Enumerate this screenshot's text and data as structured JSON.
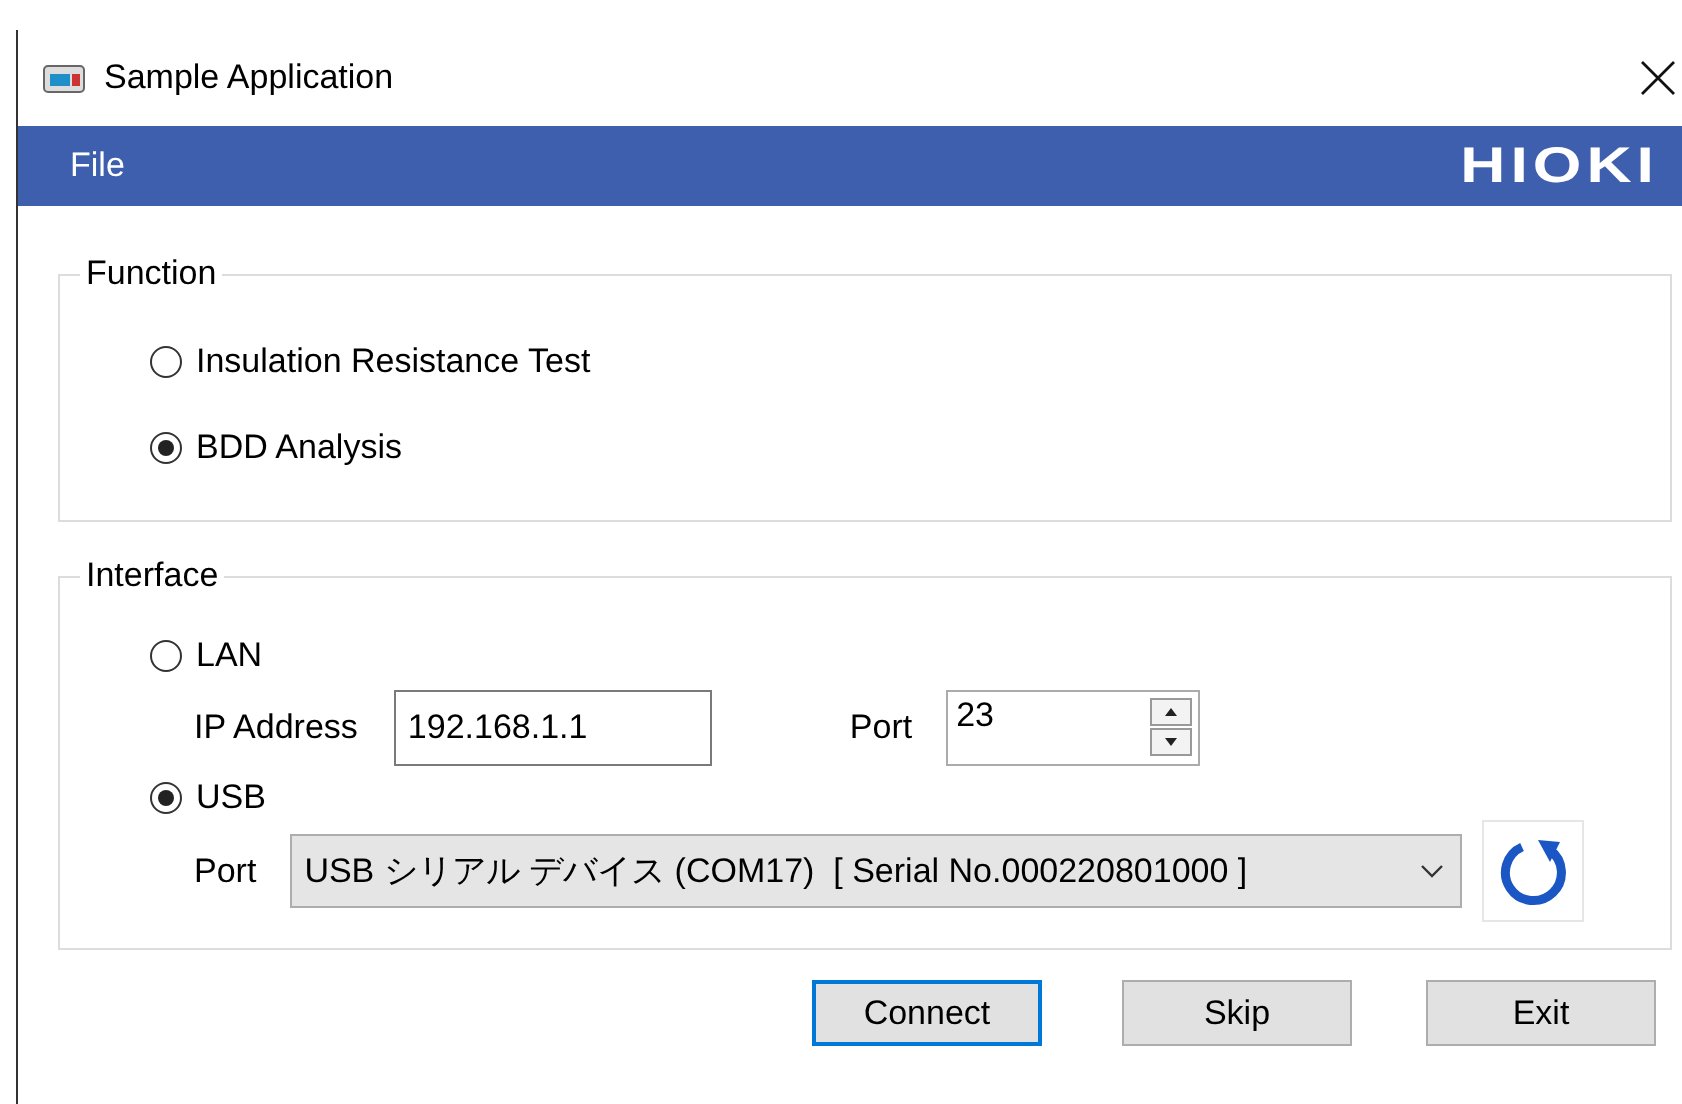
{
  "window": {
    "title": "Sample Application"
  },
  "menu": {
    "items": [
      "File"
    ],
    "logo": "HIOKI"
  },
  "function_group": {
    "title": "Function",
    "options": [
      {
        "label": "Insulation Resistance Test",
        "selected": false
      },
      {
        "label": "BDD Analysis",
        "selected": true
      }
    ]
  },
  "interface_group": {
    "title": "Interface",
    "options": [
      {
        "kind": "lan",
        "label": "LAN",
        "selected": false,
        "ip_label": "IP Address",
        "ip_value": "192.168.1.1",
        "port_label": "Port",
        "port_value": "23"
      },
      {
        "kind": "usb",
        "label": "USB",
        "selected": true,
        "port_label": "Port",
        "port_value": "USB シリアル デバイス (COM17)  [ Serial No.000220801000 ]"
      }
    ]
  },
  "buttons": [
    {
      "label": "Connect",
      "default": true
    },
    {
      "label": "Skip",
      "default": false
    },
    {
      "label": "Exit",
      "default": false
    }
  ]
}
